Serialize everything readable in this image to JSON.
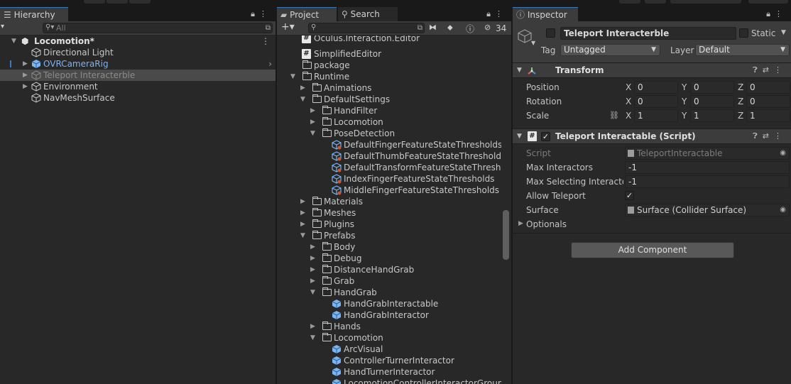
{
  "hierarchy": {
    "tab_label": "Hierarchy",
    "search_placeholder": "All",
    "scene_name": "Locomotion*",
    "items": [
      {
        "label": "Directional Light"
      },
      {
        "label": "OVRCameraRig"
      },
      {
        "label": "Teleport Interacterble"
      },
      {
        "label": "Environment"
      },
      {
        "label": "NavMeshSurface"
      }
    ]
  },
  "project": {
    "tab_label": "Project",
    "search_tab_label": "Search",
    "hidden_count": "34",
    "rows": [
      {
        "label": "Oculus.Interaction.Editor"
      },
      {
        "label": "SimplifiedEditor"
      },
      {
        "label": "package"
      },
      {
        "label": "Runtime"
      },
      {
        "label": "Animations"
      },
      {
        "label": "DefaultSettings"
      },
      {
        "label": "HandFilter"
      },
      {
        "label": "Locomotion"
      },
      {
        "label": "PoseDetection"
      },
      {
        "label": "DefaultFingerFeatureStateThresholds"
      },
      {
        "label": "DefaultThumbFeatureStateThresholds"
      },
      {
        "label": "DefaultTransformFeatureStateThresholds"
      },
      {
        "label": "IndexFingerFeatureStateThresholds"
      },
      {
        "label": "MiddleFingerFeatureStateThresholds"
      },
      {
        "label": "Materials"
      },
      {
        "label": "Meshes"
      },
      {
        "label": "Plugins"
      },
      {
        "label": "Prefabs"
      },
      {
        "label": "Body"
      },
      {
        "label": "Debug"
      },
      {
        "label": "DistanceHandGrab"
      },
      {
        "label": "Grab"
      },
      {
        "label": "HandGrab"
      },
      {
        "label": "HandGrabInteractable"
      },
      {
        "label": "HandGrabInteractor"
      },
      {
        "label": "Hands"
      },
      {
        "label": "Locomotion"
      },
      {
        "label": "ArcVisual"
      },
      {
        "label": "ControllerTurnerInteractor"
      },
      {
        "label": "HandTurnerInteractor"
      },
      {
        "label": "LocomotionControllerInteractorGroup"
      }
    ]
  },
  "inspector": {
    "tab_label": "Inspector",
    "object_name": "Teleport Interacterble",
    "static_label": "Static",
    "tag_label": "Tag",
    "tag_value": "Untagged",
    "layer_label": "Layer",
    "layer_value": "Default",
    "transform": {
      "title": "Transform",
      "position_label": "Position",
      "rotation_label": "Rotation",
      "scale_label": "Scale",
      "axis_x": "X",
      "axis_y": "Y",
      "axis_z": "Z",
      "position": [
        "0",
        "0",
        "0"
      ],
      "rotation": [
        "0",
        "0",
        "0"
      ],
      "scale": [
        "1",
        "1",
        "1"
      ]
    },
    "script_component": {
      "title": "Teleport Interactable (Script)",
      "script_label": "Script",
      "script_value": "TeleportInteractable",
      "max_interactors_label": "Max Interactors",
      "max_interactors_value": "-1",
      "max_selecting_label": "Max Selecting Interactor",
      "max_selecting_value": "-1",
      "allow_teleport_label": "Allow Teleport",
      "allow_teleport_checked": true,
      "surface_label": "Surface",
      "surface_value": "Surface (Collider Surface)",
      "optionals_label": "Optionals"
    },
    "add_component_label": "Add Component"
  },
  "colors": {
    "accent_blue": "#3a79bb",
    "prefab_blue": "#7cb3f2",
    "panel_bg": "#282828"
  }
}
